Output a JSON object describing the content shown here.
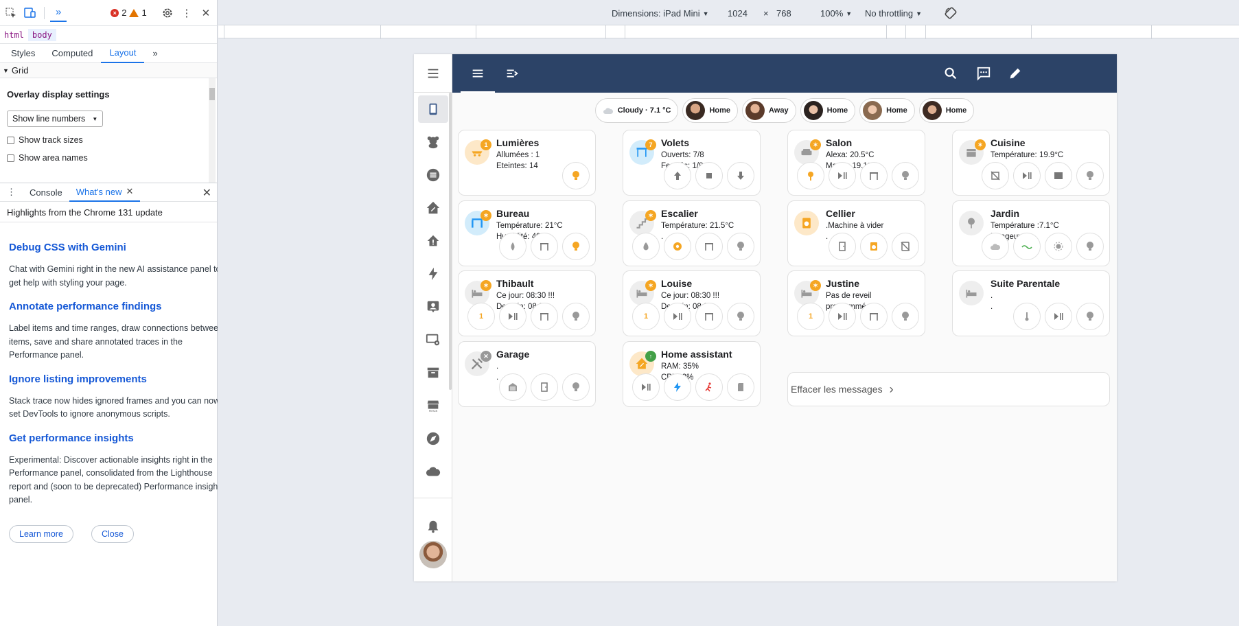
{
  "devtools": {
    "error_count": "2",
    "warning_count": "1",
    "breadcrumb": [
      "html",
      "body"
    ],
    "subtabs": [
      "Styles",
      "Computed",
      "Layout"
    ],
    "section_title": "Grid",
    "overlay_title": "Overlay display settings",
    "overlay_select": "Show line numbers",
    "checkbox_track": "Show track sizes",
    "checkbox_area": "Show area names",
    "drawer_tabs": [
      "Console",
      "What's new"
    ],
    "highlights": "Highlights from the Chrome 131 update",
    "news": [
      {
        "title": "Debug CSS with Gemini",
        "lines": [
          "Chat with Gemini right in the new AI assistance panel to",
          "get help with styling your page."
        ]
      },
      {
        "title": "Annotate performance findings",
        "lines": [
          "Label items and time ranges, draw connections between",
          "items, save and share annotated traces in the",
          "Performance panel."
        ]
      },
      {
        "title": "Ignore listing improvements",
        "lines": [
          "Stack trace now hides ignored frames and you can now",
          "set DevTools to ignore anonymous scripts."
        ]
      },
      {
        "title": "Get performance insights",
        "lines": [
          "Experimental: Discover actionable insights right in the",
          "Performance panel, consolidated from the Lighthouse",
          "report and (soon to be deprecated) Performance insights",
          "panel."
        ]
      }
    ],
    "learn_more": "Learn more",
    "close": "Close"
  },
  "device_toolbar": {
    "dimensions": "Dimensions: iPad Mini",
    "width": "1024",
    "times": "×",
    "height": "768",
    "zoom": "100%",
    "throttling": "No throttling"
  },
  "badges": [
    {
      "label": "Cloudy · 7.1 °C"
    },
    {
      "label": "Home"
    },
    {
      "label": "Away"
    },
    {
      "label": "Home"
    },
    {
      "label": "Home"
    },
    {
      "label": "Home"
    }
  ],
  "cards": [
    {
      "title": "Lumières",
      "lines": [
        "Allumées : 1",
        "Eteintes: 14"
      ],
      "dot": "1"
    },
    {
      "title": "Volets",
      "lines": [
        "Ouverts: 7/8",
        "Fermés: 1/8"
      ],
      "dot": "7"
    },
    {
      "title": "Salon",
      "lines": [
        "Alexa: 20.5°C",
        "Marsu: 19.1°C"
      ]
    },
    {
      "title": "Cuisine",
      "lines": [
        "Température: 19.9°C",
        "."
      ]
    },
    {
      "title": "Bureau",
      "lines": [
        "Température: 21°C",
        "Humidité: 49%"
      ]
    },
    {
      "title": "Escalier",
      "lines": [
        "Température: 21.5°C",
        "."
      ]
    },
    {
      "title": "Cellier",
      "lines": [
        ".Machine à vider",
        "."
      ]
    },
    {
      "title": "Jardin",
      "lines": [
        "Température :7.1°C",
        "Nuageux"
      ]
    },
    {
      "title": "Thibault",
      "lines": [
        "Ce jour: 08:30 !!!",
        "Demain: 08:30"
      ],
      "btn_num": "1"
    },
    {
      "title": "Louise",
      "lines": [
        "Ce jour: 08:30 !!!",
        "Demain: 08:30"
      ],
      "btn_num": "1"
    },
    {
      "title": "Justine",
      "lines": [
        "Pas de reveil",
        "programmé."
      ],
      "btn_num": "1"
    },
    {
      "title": "Suite Parentale",
      "lines": [
        ".",
        "."
      ]
    },
    {
      "title": "Garage",
      "lines": [
        ".",
        "."
      ]
    },
    {
      "title": "Home assistant",
      "lines": [
        "RAM: 35%",
        "CPU: 2%"
      ]
    }
  ],
  "messages": {
    "label": "Effacer les messages",
    "chevron": "›"
  },
  "colors": {
    "header": "#2c4367",
    "accent_orange": "#f5a623",
    "accent_blue": "#2196f3"
  }
}
